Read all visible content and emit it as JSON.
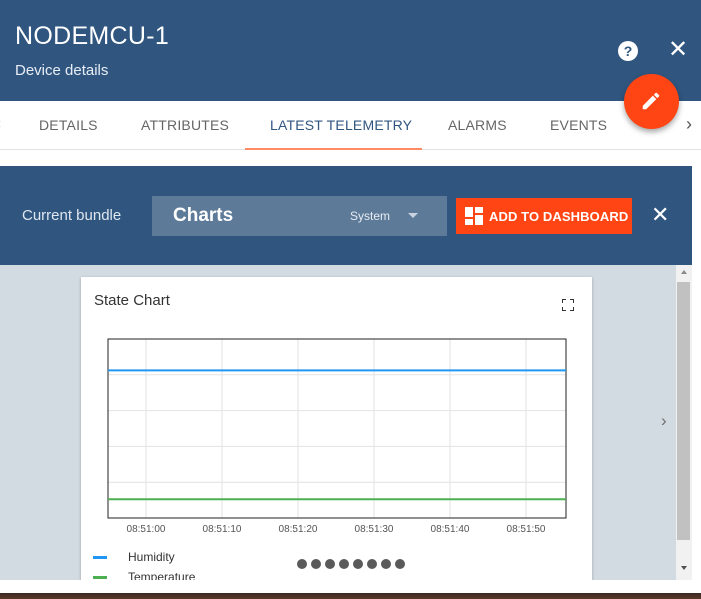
{
  "header": {
    "title": "NODEMCU-1",
    "subtitle": "Device details",
    "help_icon": "help-icon",
    "close_icon": "close-icon",
    "edit_icon": "pencil-icon",
    "background": "#305680",
    "fab_color": "#ff4514"
  },
  "tabs": {
    "items": [
      {
        "label": "DETAILS",
        "active": false
      },
      {
        "label": "ATTRIBUTES",
        "active": false
      },
      {
        "label": "LATEST TELEMETRY",
        "active": true
      },
      {
        "label": "ALARMS",
        "active": false
      },
      {
        "label": "EVENTS",
        "active": false
      }
    ],
    "left_icon": "chevron-left-icon",
    "right_icon": "chevron-right-icon"
  },
  "bundle": {
    "label": "Current bundle",
    "selected": "Charts",
    "scope": "System",
    "add_button_label": "ADD TO DASHBOARD",
    "add_button_icon": "dashboard-icon",
    "close_icon": "close-icon"
  },
  "widget": {
    "title": "State Chart",
    "fullscreen_icon": "fullscreen-icon",
    "next_icon": "chevron-right-icon",
    "page_dots": 8
  },
  "chart_data": {
    "type": "line",
    "title": "State Chart",
    "x": [
      "08:51:00",
      "08:51:10",
      "08:51:20",
      "08:51:30",
      "08:51:40",
      "08:51:50"
    ],
    "series": [
      {
        "name": "Humidity",
        "color": "#2196f3",
        "level": 0.825
      },
      {
        "name": "Temperature",
        "color": "#4caf50",
        "level": 0.105
      }
    ],
    "grid": true,
    "legend": "bottom"
  }
}
